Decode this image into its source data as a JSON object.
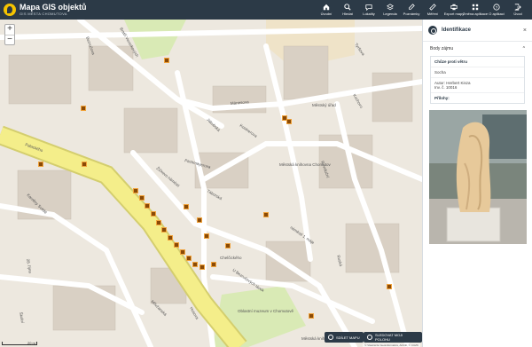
{
  "app": {
    "title": "Mapa GIS objektů",
    "subtitle": "GIS MĚSTA CHOMUTOVA"
  },
  "toolbar": [
    {
      "label": "Úvodní",
      "icon": "home-icon"
    },
    {
      "label": "Hledat",
      "icon": "search-icon"
    },
    {
      "label": "Lokality",
      "icon": "chat-icon"
    },
    {
      "label": "Legenda",
      "icon": "layers-icon"
    },
    {
      "label": "Poznámky",
      "icon": "pencil-icon"
    },
    {
      "label": "Měření",
      "icon": "ruler-icon"
    },
    {
      "label": "Export mapy",
      "icon": "print-icon"
    },
    {
      "label": "Změna aplikace",
      "icon": "grid-icon"
    },
    {
      "label": "O aplikaci",
      "icon": "help-icon"
    },
    {
      "label": "Úvod",
      "icon": "exit-icon"
    }
  ],
  "map": {
    "zoom_in": "+",
    "zoom_out": "−",
    "share_button": "SDÍLET MAPU",
    "locate_button": "SLEDOVAT MOJI POLOHU",
    "attribution": "© Vlastnictví Geoinformatics, Airbnb, © CUZK",
    "scale": "20 m",
    "streets": [
      {
        "name": "Bezručova"
      },
      {
        "name": "Bratří Veverkových"
      },
      {
        "name": "Mánesova"
      },
      {
        "name": "Kostnerova"
      },
      {
        "name": "Palackého"
      },
      {
        "name": "Pachmayerova"
      },
      {
        "name": "Žižkovo náměstí"
      },
      {
        "name": "Jakubská"
      },
      {
        "name": "Tyršova"
      },
      {
        "name": "Revoluční"
      },
      {
        "name": "Kochovo"
      },
      {
        "name": "náměstí 1. máje"
      },
      {
        "name": "Chelčického"
      },
      {
        "name": "Husova"
      },
      {
        "name": "U Bezručových lávek"
      },
      {
        "name": "Školní"
      },
      {
        "name": "28. října"
      },
      {
        "name": "Karoliny Světlé"
      },
      {
        "name": "Mřivčanská"
      },
      {
        "name": "Táborská"
      },
      {
        "name": "Ruská"
      },
      {
        "name": "Městský úřad"
      },
      {
        "name": "Oblastní muzeum v Chomutově"
      },
      {
        "name": "Městská knihovna Chomutov"
      },
      {
        "name": "Městská knihovna Chomutov"
      }
    ]
  },
  "panel": {
    "title": "Identifikace",
    "close": "×",
    "section_title": "Body zájmu",
    "caret": "^",
    "object_title": "Chůze proti větru",
    "type": "Socha",
    "author": "Autor: Herbert Kisza",
    "inventory": "Inv. č. 10016",
    "attachments_label": "Přílohy:"
  },
  "colors": {
    "header": "#2c3a47",
    "accent": "#f5c400",
    "pin": "#8a4a06",
    "major_road": "#f4ee8a",
    "building": "#d9d0c4",
    "park": "#d9eab5"
  }
}
